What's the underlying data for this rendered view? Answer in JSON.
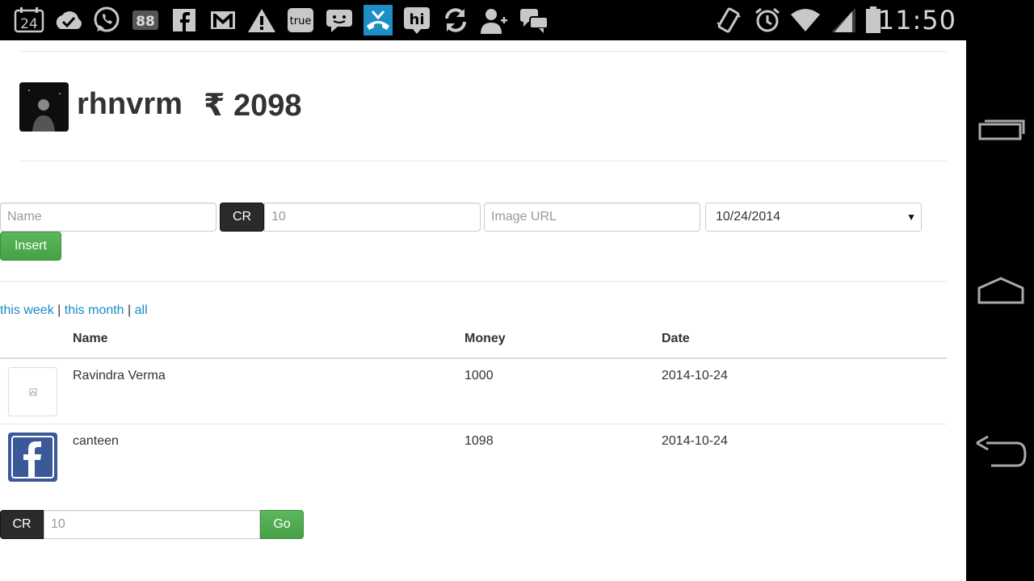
{
  "status_bar": {
    "time": "11:50",
    "notification_icons": [
      "calendar-24-icon",
      "check-circle-icon",
      "whatsapp-icon",
      "badge-88-icon",
      "facebook-icon",
      "gmail-icon",
      "warning-icon",
      "truecaller-icon",
      "messaging-icon",
      "missed-call-icon",
      "hike-icon",
      "sync-icon",
      "add-contact-icon",
      "chat-bubbles-icon"
    ],
    "calendar_day": "24",
    "badge_number": "88",
    "truecaller_label": "true",
    "hike_label": "hi",
    "system_icons": [
      "vibrate-icon",
      "alarm-icon",
      "wifi-icon",
      "signal-icon",
      "battery-icon"
    ]
  },
  "header": {
    "username": "rhnvrm",
    "balance": "₹ 2098"
  },
  "insert_form": {
    "name_placeholder": "Name",
    "cr_label": "CR",
    "amount_placeholder": "10",
    "image_url_placeholder": "Image URL",
    "date_value": "10/24/2014",
    "insert_label": "Insert"
  },
  "filters": {
    "this_week": "this week",
    "this_month": "this month",
    "all": "all",
    "separator": "|"
  },
  "table": {
    "headers": {
      "name": "Name",
      "money": "Money",
      "date": "Date"
    },
    "rows": [
      {
        "name": "Ravindra Verma",
        "money": "1000",
        "date": "2014-10-24",
        "image": "broken-image-icon"
      },
      {
        "name": "canteen",
        "money": "1098",
        "date": "2014-10-24",
        "image": "facebook-icon"
      }
    ]
  },
  "bottom_form": {
    "cr_label": "CR",
    "amount_placeholder": "10",
    "go_label": "Go"
  },
  "colors": {
    "link": "#1a8bc9",
    "green_button": "#5cb85c",
    "dark_button": "#2a2a2a",
    "facebook_blue": "#3b5998"
  }
}
